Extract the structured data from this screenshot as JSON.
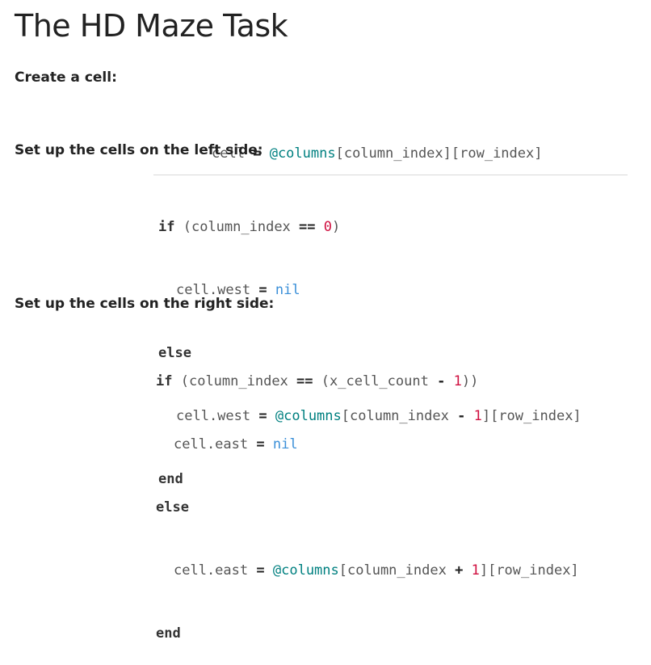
{
  "title": "The HD Maze Task",
  "sections": [
    {
      "heading": "Create a cell:"
    },
    {
      "heading": "Set up the cells on the left side:"
    },
    {
      "heading": "Set up the cells on the right side:"
    }
  ],
  "code": {
    "create_cell": {
      "lhs": "cell",
      "eq": "=",
      "ivar": "@columns",
      "index1": "[column_index]",
      "index2": "[row_index]"
    },
    "left": {
      "if_kw": "if",
      "cond_open": "(column_index",
      "cond_op": "==",
      "cond_num": "0",
      "cond_close": ")",
      "assign1_lhs": "cell.west",
      "assign1_eq": "=",
      "assign1_val": "nil",
      "else_kw": "else",
      "assign2_lhs": "cell.west",
      "assign2_eq": "=",
      "assign2_ivar": "@columns",
      "assign2_idx_open": "[column_index",
      "assign2_op": "-",
      "assign2_num": "1",
      "assign2_idx_close": "]",
      "assign2_row": "[row_index]",
      "end_kw": "end"
    },
    "right": {
      "if_kw": "if",
      "cond_open": "(column_index",
      "cond_op": "==",
      "cond_mid": "(x_cell_count",
      "cond_op2": "-",
      "cond_num": "1",
      "cond_close": "))",
      "assign1_lhs": "cell.east",
      "assign1_eq": "=",
      "assign1_val": "nil",
      "else_kw": "else",
      "assign2_lhs": "cell.east",
      "assign2_eq": "=",
      "assign2_ivar": "@columns",
      "assign2_idx_open": "[column_index",
      "assign2_op": "+",
      "assign2_num": "1",
      "assign2_idx_close": "]",
      "assign2_row": "[row_index]",
      "end_kw": "end"
    }
  }
}
